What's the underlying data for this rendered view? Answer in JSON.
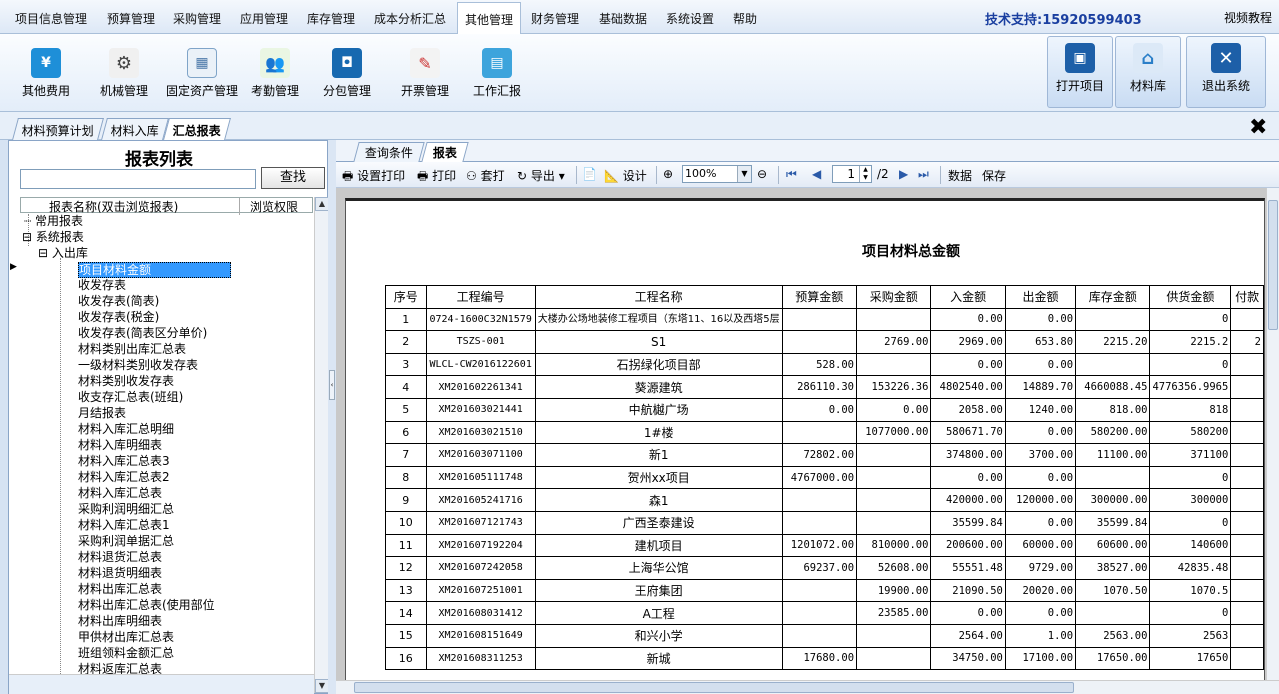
{
  "menu": {
    "items": [
      "项目信息管理",
      "预算管理",
      "采购管理",
      "应用管理",
      "库存管理",
      "成本分析汇总",
      "其他管理",
      "财务管理",
      "基础数据",
      "系统设置",
      "帮助"
    ],
    "active": "其他管理",
    "support_label": "技术支持:",
    "support_phone": "15920599403",
    "video": "视频教程"
  },
  "ribbon": {
    "buttons": [
      {
        "label": "其他费用",
        "icon": "yen-icon",
        "color": "#1e8fd8"
      },
      {
        "label": "机械管理",
        "icon": "gear-icon",
        "color": "#555555"
      },
      {
        "label": "固定资产管理",
        "icon": "ledger-icon",
        "color": "#7fa4c8"
      },
      {
        "label": "考勤管理",
        "icon": "people-icon",
        "color": "#6aa84f"
      },
      {
        "label": "分包管理",
        "icon": "package-icon",
        "color": "#1769b0"
      },
      {
        "label": "开票管理",
        "icon": "invoice-icon",
        "color": "#b0b0b0"
      },
      {
        "label": "工作汇报",
        "icon": "report-icon",
        "color": "#3da4dc"
      }
    ],
    "right_buttons": [
      {
        "label": "打开项目",
        "icon": "open-project-icon",
        "color": "#1d5fa8"
      },
      {
        "label": "材料库",
        "icon": "warehouse-icon",
        "color": "#2b7fc8"
      },
      {
        "label": "退出系统",
        "icon": "exit-icon",
        "color": "#1d5fa8"
      }
    ]
  },
  "page_tabs": [
    "材料预算计划",
    "材料入库",
    "汇总报表"
  ],
  "page_tab_active": "汇总报表",
  "left": {
    "title": "报表列表",
    "find_button": "查找",
    "search_value": "",
    "col_name": "报表名称(双击浏览报表)",
    "col_perm": "浏览权限",
    "tree": {
      "common": "常用报表",
      "system": "系统报表",
      "inout": "入出库",
      "items": [
        "项目材料金额",
        "收发存表",
        "收发存表(简表)",
        "收发存表(税金)",
        "收发存表(简表区分单价)",
        "材料类别出库汇总表",
        "一级材料类别收发存表",
        "材料类别收发存表",
        "收支存汇总表(班组)",
        "月结报表",
        "材料入库汇总明细",
        "材料入库明细表",
        "材料入库汇总表3",
        "材料入库汇总表2",
        "材料入库汇总表",
        "采购利润明细汇总",
        "材料入库汇总表1",
        "采购利润单据汇总",
        "材料退货汇总表",
        "材料退货明细表",
        "材料出库汇总表",
        "材料出库汇总表(使用部位",
        "材料出库明细表",
        "甲供材出库汇总表",
        "班组领料金额汇总",
        "材料返库汇总表"
      ]
    }
  },
  "right": {
    "tabs": [
      "查询条件",
      "报表"
    ],
    "active_tab": "报表",
    "toolbar": {
      "print_setup": "设置打印",
      "print": "打印",
      "overlay": "套打",
      "export": "导出",
      "design": "设计",
      "zoom": "100%",
      "page": "1",
      "page_total": "/2",
      "data": "数据",
      "save": "保存"
    },
    "report": {
      "title": "项目材料总金额",
      "headers": [
        "序号",
        "工程编号",
        "工程名称",
        "预算金额",
        "采购金额",
        "入金额",
        "出金额",
        "库存金额",
        "供货金额",
        "付款"
      ],
      "rows": [
        [
          "1",
          "0724-1600C32N1579",
          "大楼办公场地装修工程项目（东塔11、16以及西塔5层",
          "",
          "",
          "0.00",
          "0.00",
          "",
          "0",
          ""
        ],
        [
          "2",
          "TSZS-001",
          "S1",
          "",
          "2769.00",
          "2969.00",
          "653.80",
          "2215.20",
          "2215.2",
          "2"
        ],
        [
          "3",
          "WLCL-CW2016122601",
          "石拐绿化项目部",
          "528.00",
          "",
          "0.00",
          "0.00",
          "",
          "0",
          ""
        ],
        [
          "4",
          "XM201602261341",
          "葵源建筑",
          "286110.30",
          "153226.36",
          "4802540.00",
          "14889.70",
          "4660088.45",
          "4776356.9965",
          ""
        ],
        [
          "5",
          "XM201603021441",
          "中航樾广场",
          "0.00",
          "0.00",
          "2058.00",
          "1240.00",
          "818.00",
          "818",
          ""
        ],
        [
          "6",
          "XM201603021510",
          "1#楼",
          "",
          "1077000.00",
          "580671.70",
          "0.00",
          "580200.00",
          "580200",
          ""
        ],
        [
          "7",
          "XM201603071100",
          "新1",
          "72802.00",
          "",
          "374800.00",
          "3700.00",
          "11100.00",
          "371100",
          ""
        ],
        [
          "8",
          "XM201605111748",
          "贺州xx项目",
          "4767000.00",
          "",
          "0.00",
          "0.00",
          "",
          "0",
          ""
        ],
        [
          "9",
          "XM201605241716",
          "森1",
          "",
          "",
          "420000.00",
          "120000.00",
          "300000.00",
          "300000",
          ""
        ],
        [
          "10",
          "XM201607121743",
          "广西圣泰建设",
          "",
          "",
          "35599.84",
          "0.00",
          "35599.84",
          "0",
          ""
        ],
        [
          "11",
          "XM201607192204",
          "建机项目",
          "1201072.00",
          "810000.00",
          "200600.00",
          "60000.00",
          "60600.00",
          "140600",
          ""
        ],
        [
          "12",
          "XM201607242058",
          "上海华公馆",
          "69237.00",
          "52608.00",
          "55551.48",
          "9729.00",
          "38527.00",
          "42835.48",
          ""
        ],
        [
          "13",
          "XM201607251001",
          "王府集团",
          "",
          "19900.00",
          "21090.50",
          "20020.00",
          "1070.50",
          "1070.5",
          ""
        ],
        [
          "14",
          "XM201608031412",
          "A工程",
          "",
          "23585.00",
          "0.00",
          "0.00",
          "",
          "0",
          ""
        ],
        [
          "15",
          "XM201608151649",
          "和兴小学",
          "",
          "",
          "2564.00",
          "1.00",
          "2563.00",
          "2563",
          ""
        ],
        [
          "16",
          "XM201608311253",
          "新城",
          "17680.00",
          "",
          "34750.00",
          "17100.00",
          "17650.00",
          "17650",
          ""
        ]
      ]
    }
  }
}
